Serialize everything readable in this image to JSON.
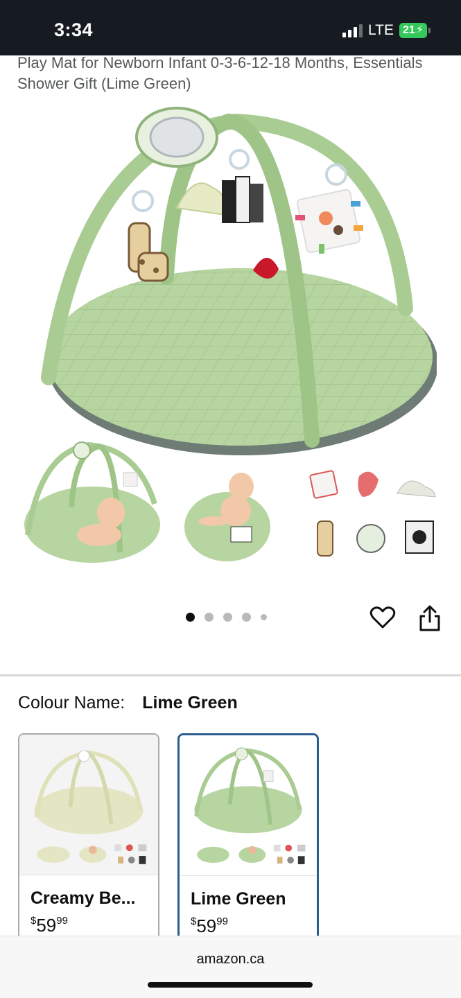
{
  "status": {
    "time": "3:34",
    "network": "LTE",
    "battery": "21"
  },
  "product": {
    "title_fragment": "Play Mat for Newborn Infant 0-3-6-12-18 Months, Essentials Shower Gift (Lime Green)"
  },
  "carousel": {
    "dot_count": 5,
    "active_index": 0
  },
  "icons": {
    "favorite": "heart-icon",
    "share": "share-icon"
  },
  "variation": {
    "label": "Colour Name:",
    "selected": "Lime Green",
    "options": [
      {
        "name": "Creamy Be...",
        "currency": "$",
        "whole": "59",
        "cents": "99",
        "selected": false
      },
      {
        "name": "Lime Green",
        "currency": "$",
        "whole": "59",
        "cents": "99",
        "selected": true
      }
    ]
  },
  "browser": {
    "url": "amazon.ca"
  },
  "colors": {
    "accent_border": "#2b5d91",
    "mat_green": "#b9d7a4",
    "status_bar": "#161b22"
  }
}
